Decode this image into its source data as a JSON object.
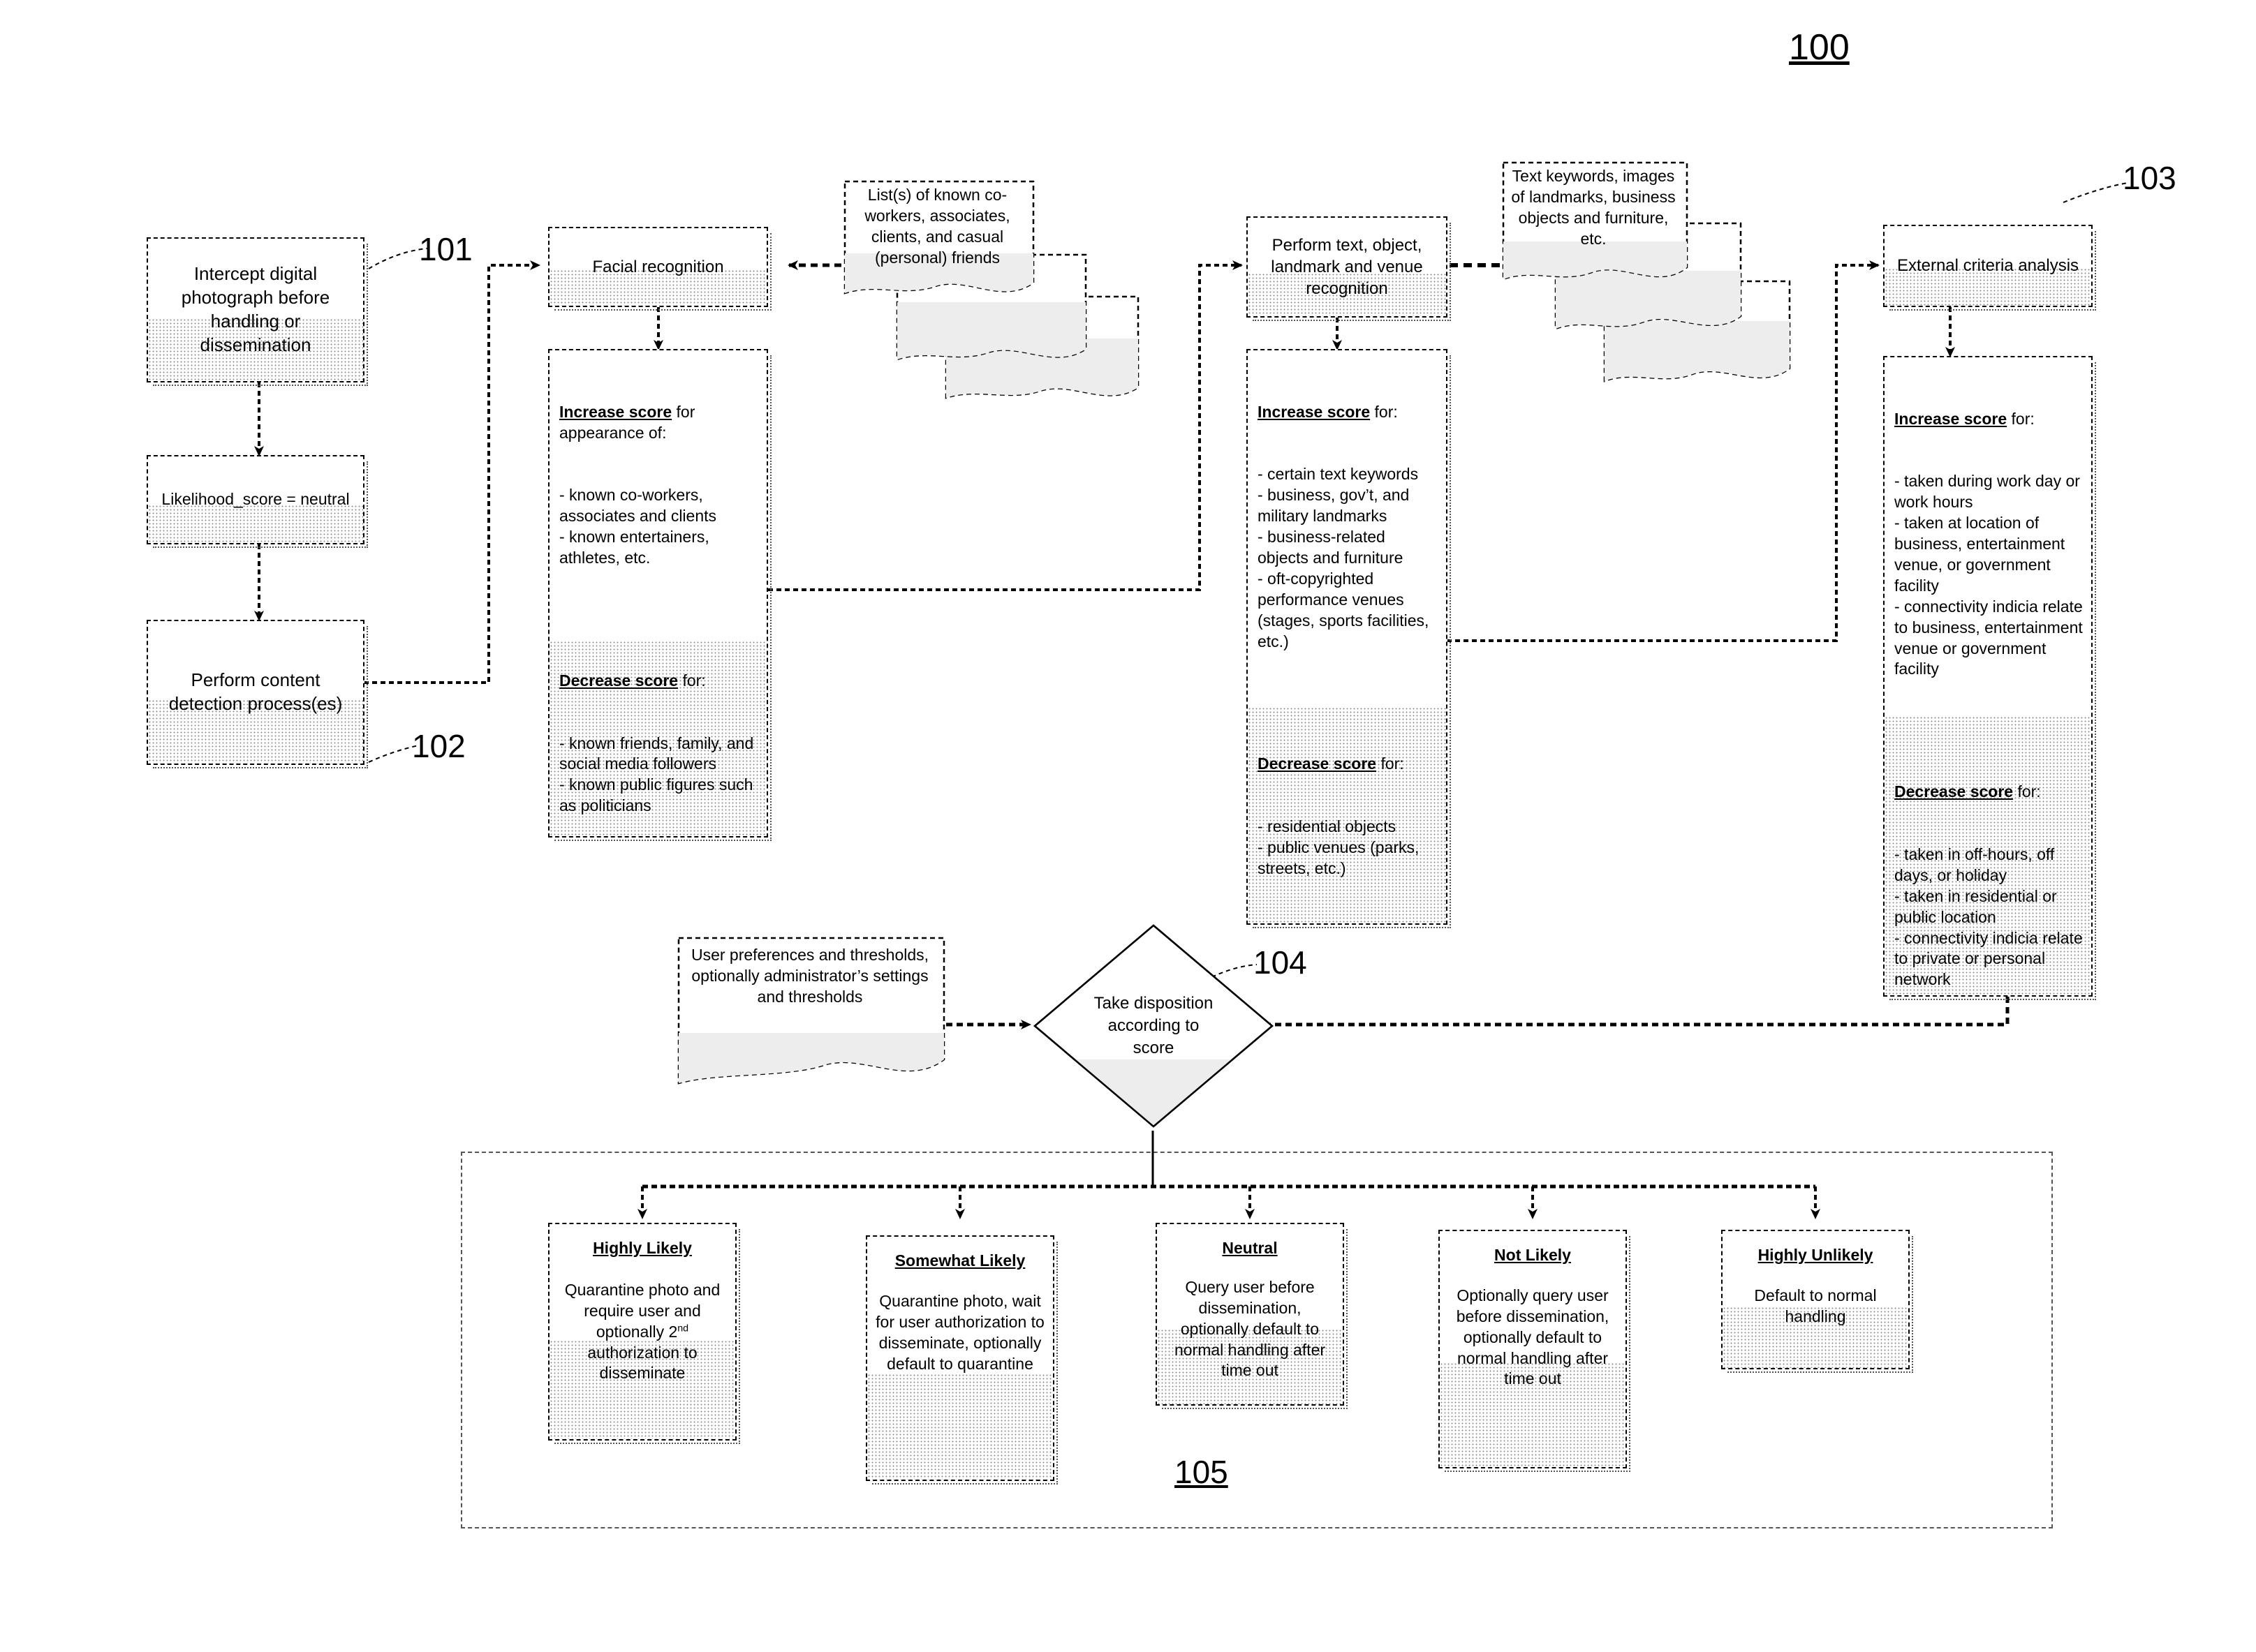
{
  "figure": {
    "number": "100",
    "refs": {
      "r101": "101",
      "r102": "102",
      "r103": "103",
      "r104": "104",
      "r105": "105"
    }
  },
  "nodes": {
    "intercept": "Intercept digital photograph before handling or dissemination",
    "likelihood": "Likelihood_score = neutral",
    "content_detection": "Perform content detection process(es)",
    "facial_recognition": "Facial recognition",
    "text_object_recognition": "Perform text, object, landmark and venue recognition",
    "external_criteria": "External criteria analysis"
  },
  "data_stores": {
    "lists": "List(s) of known co-workers, associates, clients, and casual (personal) friends",
    "keywords": "Text keywords, images of landmarks, business objects and furniture,  etc.",
    "user_prefs": "User preferences and thresholds, optionally administrator’s settings and thresholds"
  },
  "decision": {
    "take_disposition": "Take disposition according to score"
  },
  "score_panels": {
    "facial": {
      "increase_header": "Increase score",
      "increase_rest": " for appearance of:",
      "increase_items": "- known co-workers, associates and clients\n- known entertainers, athletes, etc.",
      "decrease_header": "Decrease score",
      "decrease_rest": " for:",
      "decrease_items": "- known friends, family, and social media followers\n- known public figures such as politicians"
    },
    "text_object": {
      "increase_header": "Increase score",
      "increase_rest": " for:",
      "increase_items": "- certain text keywords\n- business, gov’t, and military landmarks\n- business-related objects and furniture\n- oft-copyrighted performance venues (stages, sports facilities, etc.)",
      "decrease_header": "Decrease score",
      "decrease_rest": " for:",
      "decrease_items": "- residential objects\n- public venues (parks, streets, etc.)"
    },
    "external": {
      "increase_header": "Increase score",
      "increase_rest": " for:",
      "increase_items": "- taken during work day or work hours\n- taken at location of business, entertainment venue, or government facility\n- connectivity indicia relate to business, entertainment venue or government facility",
      "decrease_header": "Decrease score",
      "decrease_rest": " for:",
      "decrease_items": "- taken in off-hours, off days, or holiday\n- taken in residential or public location\n- connectivity indicia relate to private or personal network"
    }
  },
  "dispositions": [
    {
      "title": "Highly Likely",
      "body": "Quarantine photo and require user and optionally 2nd authorization to disseminate",
      "body_pre": "Quarantine photo and require user and optionally 2",
      "body_sup": "nd",
      "body_post": " authorization to disseminate"
    },
    {
      "title": "Somewhat Likely",
      "body": "Quarantine photo, wait for user authorization to disseminate, optionally default to quarantine"
    },
    {
      "title": "Neutral",
      "body": "Query user before dissemination, optionally default to normal handling after time out"
    },
    {
      "title": "Not Likely",
      "body": "Optionally query user before dissemination, optionally default to normal handling after time out"
    },
    {
      "title": "Highly Unlikely",
      "body": "Default to normal handling"
    }
  ],
  "colors": {
    "line": "#000000",
    "fill": "#ffffff",
    "stipple": "#8a8a8a"
  }
}
